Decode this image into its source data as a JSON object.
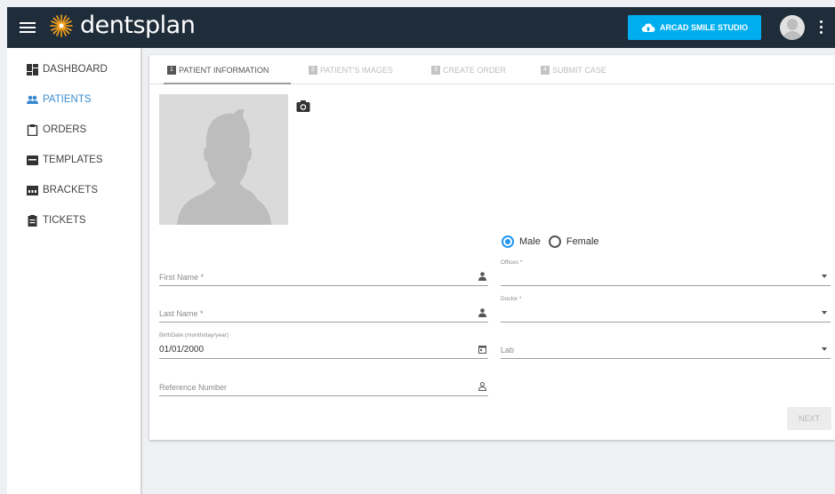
{
  "header": {
    "brand": "dentsplan",
    "studio_button": "ARCAD SMILE STUDIO"
  },
  "sidebar": {
    "items": [
      {
        "label": "DASHBOARD",
        "icon": "dashboard-icon"
      },
      {
        "label": "PATIENTS",
        "icon": "people-icon",
        "active": true
      },
      {
        "label": "ORDERS",
        "icon": "clipboard-icon"
      },
      {
        "label": "TEMPLATES",
        "icon": "template-icon"
      },
      {
        "label": "BRACKETS",
        "icon": "brackets-icon"
      },
      {
        "label": "TICKETS",
        "icon": "ticket-icon"
      }
    ]
  },
  "tabs": [
    {
      "num": "1",
      "label": "PATIENT INFORMATION",
      "active": true
    },
    {
      "num": "2",
      "label": "PATIENT'S IMAGES"
    },
    {
      "num": "3",
      "label": "CREATE ORDER"
    },
    {
      "num": "4",
      "label": "SUBMIT CASE"
    }
  ],
  "gender": {
    "male": "Male",
    "female": "Female",
    "selected": "Male"
  },
  "form": {
    "first_name": {
      "placeholder": "First Name *"
    },
    "last_name": {
      "placeholder": "Last Name *"
    },
    "birthdate": {
      "label": "BirthDate (month/day/year)",
      "value": "01/01/2000"
    },
    "reference": {
      "placeholder": "Reference Number"
    },
    "offices": {
      "label": "Offices *"
    },
    "doctor": {
      "label": "Doctor *"
    },
    "lab": {
      "placeholder": "Lab"
    }
  },
  "next_button": "NEXT",
  "colors": {
    "topbar": "#1f2d3a",
    "accent": "#00aeef",
    "active_nav": "#3a8bd0",
    "radio": "#2196f3"
  }
}
